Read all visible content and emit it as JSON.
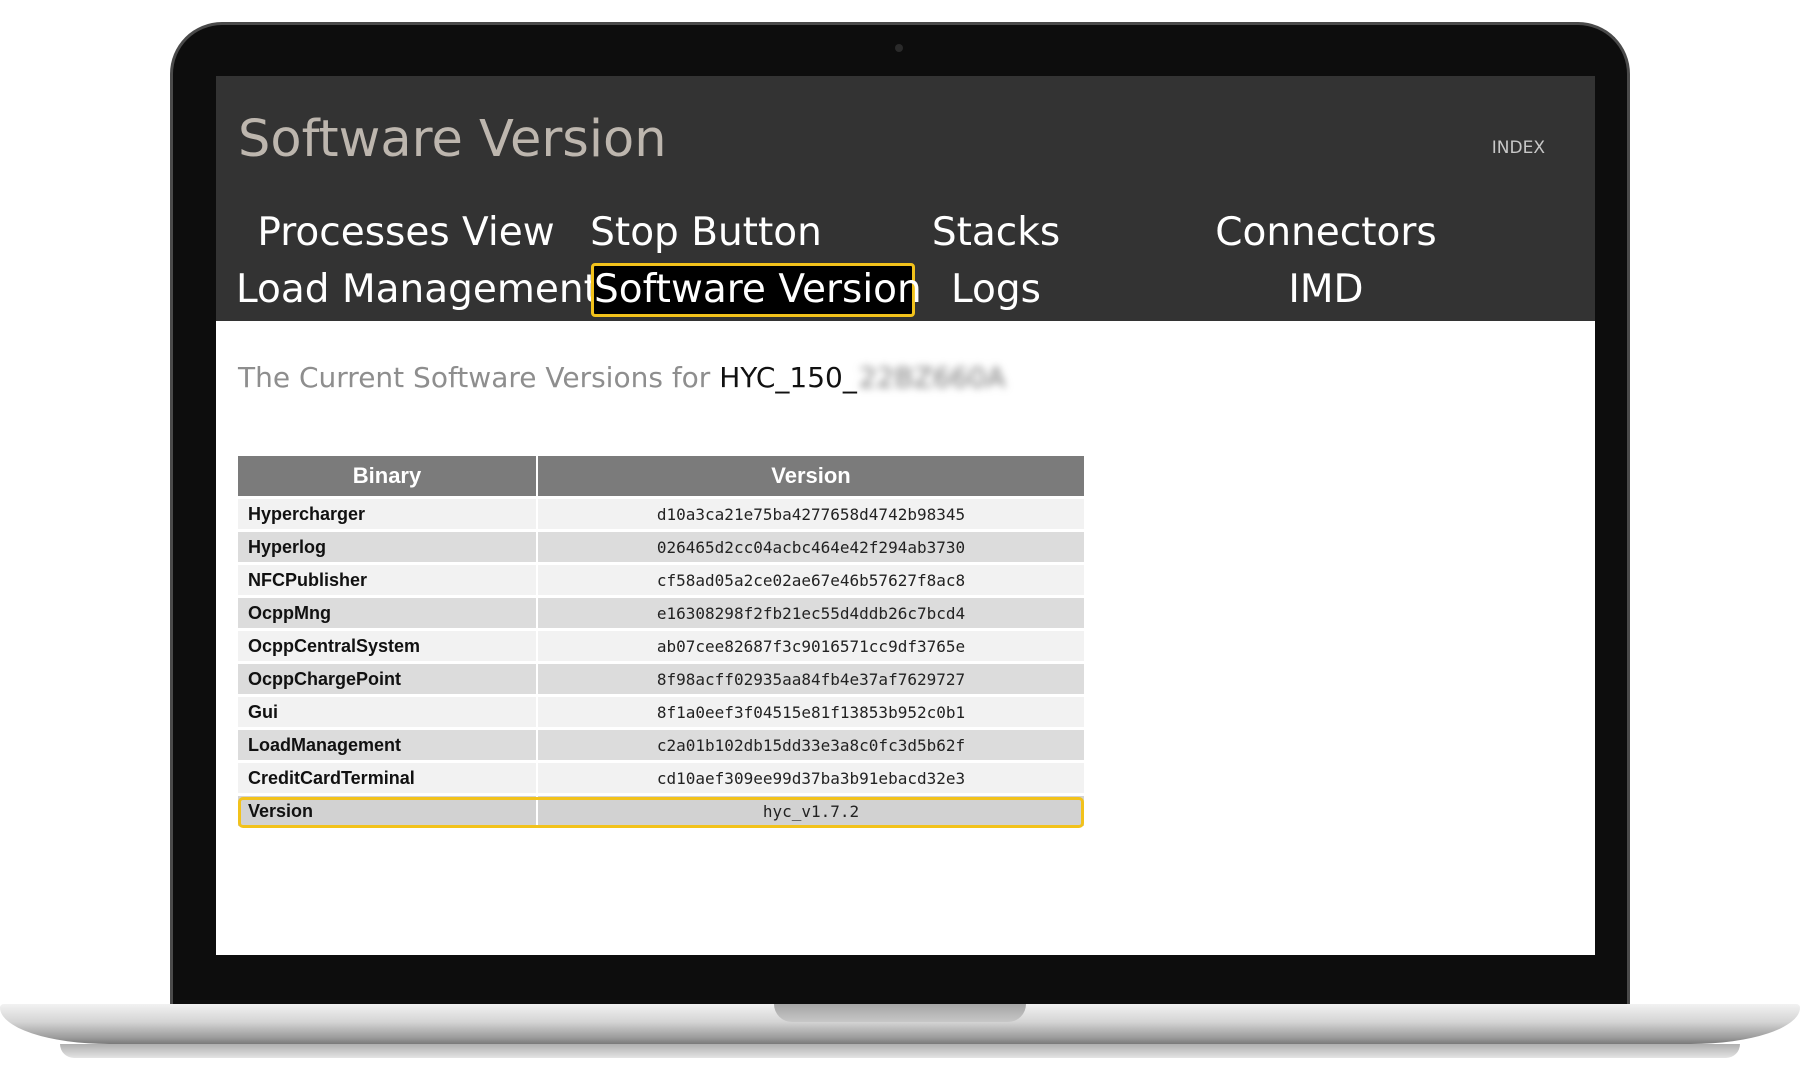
{
  "header": {
    "title": "Software Version",
    "index_label": "INDEX"
  },
  "nav": {
    "items": [
      {
        "label": "Processes View"
      },
      {
        "label": "Stop Button"
      },
      {
        "label": "Stacks"
      },
      {
        "label": "Connectors"
      },
      {
        "label": "Load Management"
      },
      {
        "label": "Software Version",
        "active": true
      },
      {
        "label": "Logs"
      },
      {
        "label": "IMD"
      }
    ]
  },
  "content": {
    "subtitle_prefix": "The Current Software Versions for ",
    "host_name": "HYC_150_",
    "host_suffix_obscured": "22BZ660A",
    "table": {
      "headers": [
        "Binary",
        "Version"
      ],
      "rows": [
        {
          "binary": "Hypercharger",
          "version": "d10a3ca21e75ba4277658d4742b98345"
        },
        {
          "binary": "Hyperlog",
          "version": "026465d2cc04acbc464e42f294ab3730"
        },
        {
          "binary": "NFCPublisher",
          "version": "cf58ad05a2ce02ae67e46b57627f8ac8"
        },
        {
          "binary": "OcppMng",
          "version": "e16308298f2fb21ec55d4ddb26c7bcd4"
        },
        {
          "binary": "OcppCentralSystem",
          "version": "ab07cee82687f3c9016571cc9df3765e"
        },
        {
          "binary": "OcppChargePoint",
          "version": "8f98acff02935aa84fb4e37af7629727"
        },
        {
          "binary": "Gui",
          "version": "8f1a0eef3f04515e81f13853b952c0b1"
        },
        {
          "binary": "LoadManagement",
          "version": "c2a01b102db15dd33e3a8c0fc3d5b62f"
        },
        {
          "binary": "CreditCardTerminal",
          "version": "cd10aef309ee99d37ba3b91ebacd32e3"
        },
        {
          "binary": "Version",
          "version": "hyc_v1.7.2",
          "highlighted": true
        }
      ]
    }
  },
  "colors": {
    "header_bg": "#333333",
    "accent_highlight": "#f2c21b",
    "table_header_bg": "#7b7b7b"
  }
}
